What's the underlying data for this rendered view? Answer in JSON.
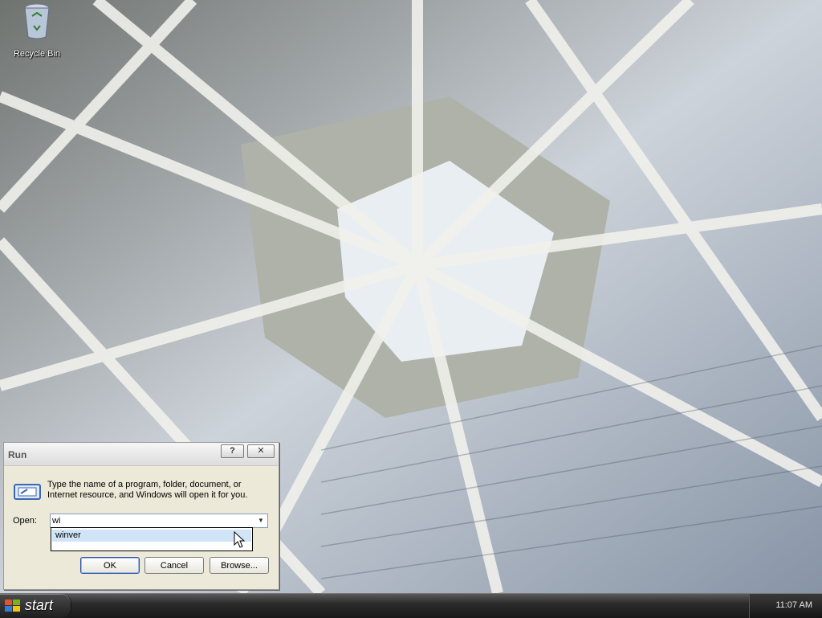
{
  "desktop": {
    "icons": [
      {
        "label": "Recycle Bin",
        "icon": "recycle-bin-icon"
      }
    ]
  },
  "run_dialog": {
    "title": "Run",
    "help_label": "?",
    "close_label": "✕",
    "description": "Type the name of a program, folder, document, or Internet resource, and Windows will open it for you.",
    "open_label": "Open:",
    "open_value": "wi",
    "autocomplete": [
      "winver"
    ],
    "buttons": {
      "ok": "OK",
      "cancel": "Cancel",
      "browse": "Browse..."
    }
  },
  "taskbar": {
    "start_label": "start",
    "clock": "11:07 AM"
  }
}
